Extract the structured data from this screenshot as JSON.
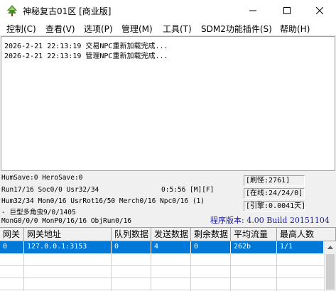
{
  "window": {
    "title": "神秘复古01区 [商业版]",
    "icon": "green-tree-app-icon"
  },
  "menu": [
    "控制(C)",
    "查看(V)",
    "选项(P)",
    "管理(M)",
    "工具(T)",
    "SDM2功能插件(S)",
    "帮助(H)"
  ],
  "log": [
    "2026-2-21 22:13:19 交易NPC重新加载完成...",
    "2026-2-21 22:13:19 管理NPC重新加载完成..."
  ],
  "status": {
    "line1": "HumSave:0 HeroSave:0",
    "line2_left": "Run17/16 Soc0/0 Usr32/34",
    "line2_right": "0:5:56 [M][F]",
    "line3": "Hum32/34 Mon0/16 UsrRot16/50 Merch0/16 Npc0/16 (1)",
    "line4": " - 巨型多角虫9/0/1405",
    "line5": "MonG0/0/0 MonP0/16/16 ObjRun0/16",
    "refresh": "[刷怪:2761]",
    "online": "[在线:24/24/0]",
    "engine": "[引擎:0.0041天]",
    "version": "程序版本: 4.00 Build 20151104"
  },
  "grid": {
    "headers": [
      "网关",
      "网关地址",
      "队列数据",
      "发送数据",
      "剩余数据",
      "平均流量",
      "最高人数"
    ],
    "rows": [
      [
        "0",
        "127.0.0.1:3153",
        "0",
        "4",
        "0",
        "262b",
        "1/1"
      ]
    ]
  },
  "colors": {
    "selection": "#0078d7",
    "version_text": "#1a1a9c"
  }
}
